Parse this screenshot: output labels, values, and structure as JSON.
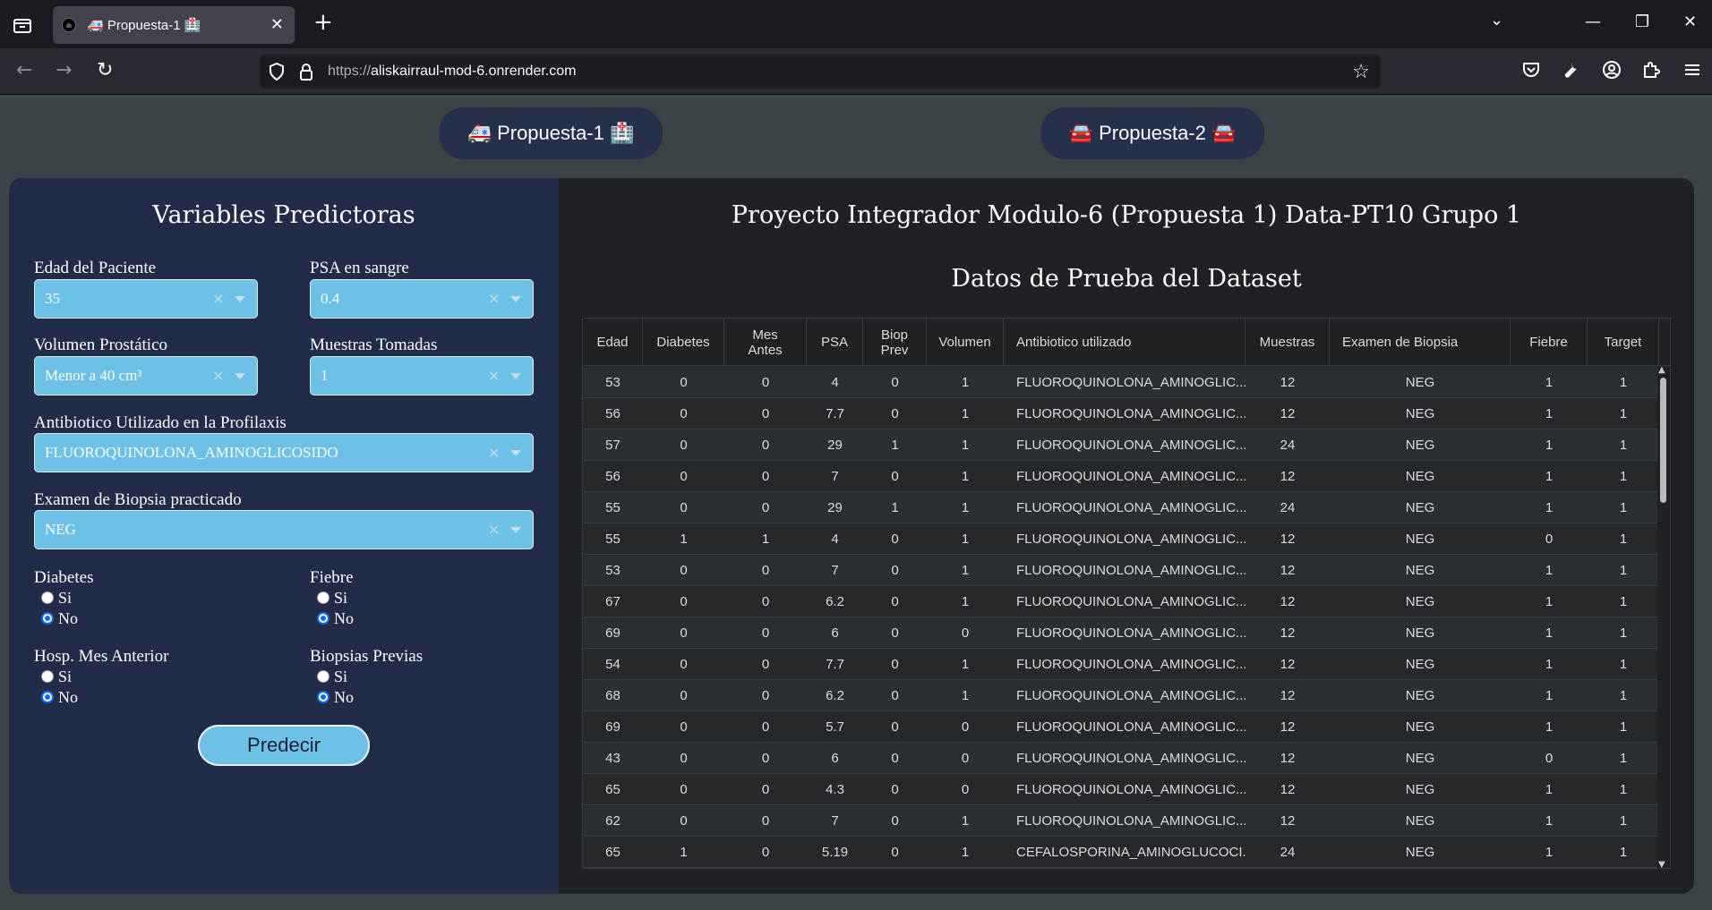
{
  "browser": {
    "tab_title": "🚑 Propuesta-1 🏥",
    "tab_favicon_text": "ılı",
    "url_scheme": "https://",
    "url_host": "aliskairraul-mod-6.onrender.com"
  },
  "nav": {
    "propuesta1_label": "🚑 Propuesta-1 🏥",
    "propuesta2_label": "🚘 Propuesta-2 🚘"
  },
  "form": {
    "title": "Variables Predictoras",
    "edad_label": "Edad del Paciente",
    "edad_value": "35",
    "psa_label": "PSA en sangre",
    "psa_value": "0.4",
    "volumen_label": "Volumen Prostático",
    "volumen_value": "Menor a 40 cm³",
    "muestras_label": "Muestras Tomadas",
    "muestras_value": "1",
    "antibiotico_label": "Antibiotico Utilizado en la Profilaxis",
    "antibiotico_value": "FLUOROQUINOLONA_AMINOGLICOSIDO",
    "biopsia_label": "Examen de Biopsia practicado",
    "biopsia_value": "NEG",
    "diabetes_label": "Diabetes",
    "fiebre_label": "Fiebre",
    "hosp_label": "Hosp. Mes Anterior",
    "biopsias_prev_label": "Biopsias Previas",
    "yes_label": "Si",
    "no_label": "No",
    "predict_label": "Predecir"
  },
  "results": {
    "title": "Proyecto Integrador Modulo-6 (Propuesta 1) Data-PT10 Grupo 1",
    "subtitle": "Datos de Prueba del Dataset"
  },
  "table": {
    "columns": [
      "Edad",
      "Diabetes",
      "Mes Antes",
      "PSA",
      "Biop Prev",
      "Volumen",
      "Antibiotico utilizado",
      "Muestras",
      "Examen de Biopsia",
      "Fiebre",
      "Target"
    ],
    "rows": [
      [
        "53",
        "0",
        "0",
        "4",
        "0",
        "1",
        "FLUOROQUINOLONA_AMINOGLIC...",
        "12",
        "NEG",
        "1",
        "1"
      ],
      [
        "56",
        "0",
        "0",
        "7.7",
        "0",
        "1",
        "FLUOROQUINOLONA_AMINOGLIC...",
        "12",
        "NEG",
        "1",
        "1"
      ],
      [
        "57",
        "0",
        "0",
        "29",
        "1",
        "1",
        "FLUOROQUINOLONA_AMINOGLIC...",
        "24",
        "NEG",
        "1",
        "1"
      ],
      [
        "56",
        "0",
        "0",
        "7",
        "0",
        "1",
        "FLUOROQUINOLONA_AMINOGLIC...",
        "12",
        "NEG",
        "1",
        "1"
      ],
      [
        "55",
        "0",
        "0",
        "29",
        "1",
        "1",
        "FLUOROQUINOLONA_AMINOGLIC...",
        "24",
        "NEG",
        "1",
        "1"
      ],
      [
        "55",
        "1",
        "1",
        "4",
        "0",
        "1",
        "FLUOROQUINOLONA_AMINOGLIC...",
        "12",
        "NEG",
        "0",
        "1"
      ],
      [
        "53",
        "0",
        "0",
        "7",
        "0",
        "1",
        "FLUOROQUINOLONA_AMINOGLIC...",
        "12",
        "NEG",
        "1",
        "1"
      ],
      [
        "67",
        "0",
        "0",
        "6.2",
        "0",
        "1",
        "FLUOROQUINOLONA_AMINOGLIC...",
        "12",
        "NEG",
        "1",
        "1"
      ],
      [
        "69",
        "0",
        "0",
        "6",
        "0",
        "0",
        "FLUOROQUINOLONA_AMINOGLIC...",
        "12",
        "NEG",
        "1",
        "1"
      ],
      [
        "54",
        "0",
        "0",
        "7.7",
        "0",
        "1",
        "FLUOROQUINOLONA_AMINOGLIC...",
        "12",
        "NEG",
        "1",
        "1"
      ],
      [
        "68",
        "0",
        "0",
        "6.2",
        "0",
        "1",
        "FLUOROQUINOLONA_AMINOGLIC...",
        "12",
        "NEG",
        "1",
        "1"
      ],
      [
        "69",
        "0",
        "0",
        "5.7",
        "0",
        "0",
        "FLUOROQUINOLONA_AMINOGLIC...",
        "12",
        "NEG",
        "1",
        "1"
      ],
      [
        "43",
        "0",
        "0",
        "6",
        "0",
        "0",
        "FLUOROQUINOLONA_AMINOGLIC...",
        "12",
        "NEG",
        "0",
        "1"
      ],
      [
        "65",
        "0",
        "0",
        "4.3",
        "0",
        "0",
        "FLUOROQUINOLONA_AMINOGLIC...",
        "12",
        "NEG",
        "1",
        "1"
      ],
      [
        "62",
        "0",
        "0",
        "7",
        "0",
        "1",
        "FLUOROQUINOLONA_AMINOGLIC...",
        "12",
        "NEG",
        "1",
        "1"
      ],
      [
        "65",
        "1",
        "0",
        "5.19",
        "0",
        "1",
        "CEFALOSPORINA_AMINOGLUCOCI...",
        "24",
        "NEG",
        "1",
        "1"
      ]
    ]
  }
}
